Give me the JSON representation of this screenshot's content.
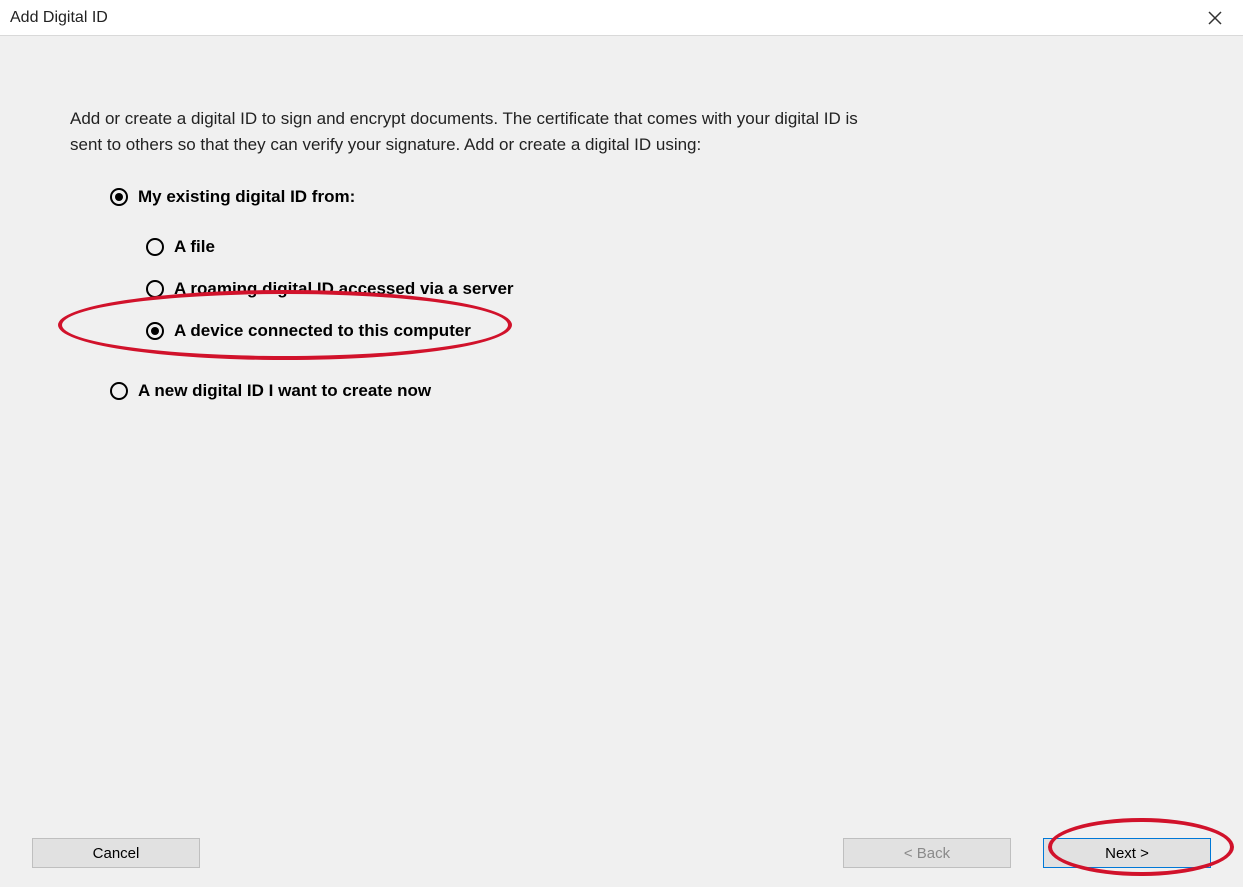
{
  "window": {
    "title": "Add Digital ID"
  },
  "intro": "Add or create a digital ID to sign and encrypt documents. The certificate that comes with your digital ID is sent to others so that they can verify your signature. Add or create a digital ID using:",
  "options": {
    "existing": {
      "label": "My existing digital ID from:",
      "selected": true,
      "sub": {
        "file": {
          "label": "A file",
          "selected": false
        },
        "server": {
          "label": "A roaming digital ID accessed via a server",
          "selected": false
        },
        "device": {
          "label": "A device connected to this computer",
          "selected": true
        }
      }
    },
    "create": {
      "label": "A new digital ID I want to create now",
      "selected": false
    }
  },
  "buttons": {
    "cancel": "Cancel",
    "back": "< Back",
    "next": "Next >"
  }
}
